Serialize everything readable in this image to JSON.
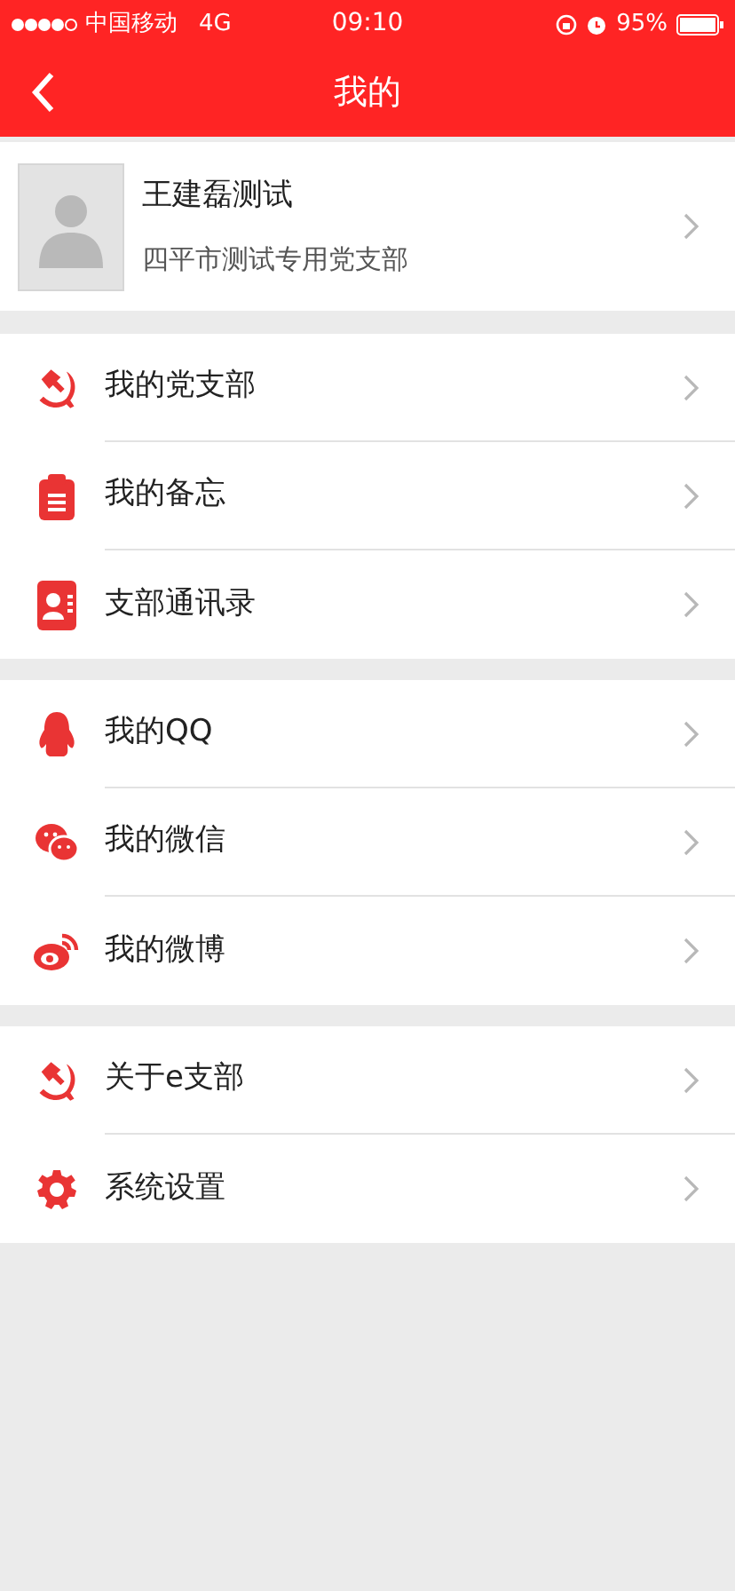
{
  "status_bar": {
    "carrier": "中国移动",
    "network": "4G",
    "time": "09:10",
    "battery": "95%"
  },
  "nav_bar": {
    "title": "我的"
  },
  "profile": {
    "name": "王建磊测试",
    "branch": "四平市测试专用党支部"
  },
  "menu_groups": [
    {
      "items": [
        {
          "label": "我的党支部"
        },
        {
          "label": "我的备忘"
        },
        {
          "label": "支部通讯录"
        }
      ]
    },
    {
      "items": [
        {
          "label": "我的QQ"
        },
        {
          "label": "我的微信"
        },
        {
          "label": "我的微博"
        }
      ]
    },
    {
      "items": [
        {
          "label": "关于e支部"
        },
        {
          "label": "系统设置"
        }
      ]
    }
  ]
}
